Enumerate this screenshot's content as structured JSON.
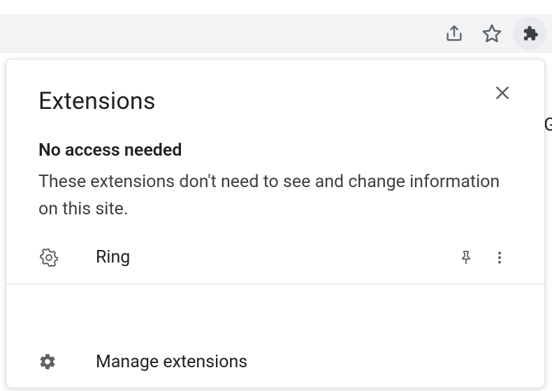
{
  "popup": {
    "title": "Extensions",
    "section_heading": "No access needed",
    "section_description": "These extensions don't need to see and change information on this site.",
    "extension": {
      "name": "Ring"
    },
    "footer_label": "Manage extensions"
  },
  "edge_glyph": "G",
  "icons": {
    "share": "share-icon",
    "star": "star-icon",
    "puzzle": "puzzle-icon",
    "close": "close-icon",
    "gear_outline": "gear-outline-icon",
    "pin": "pin-icon",
    "more": "more-vert-icon",
    "gear_solid": "gear-solid-icon"
  }
}
